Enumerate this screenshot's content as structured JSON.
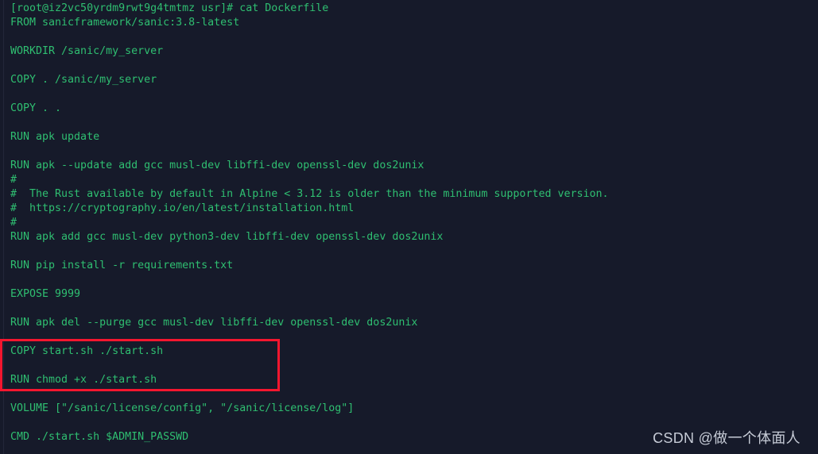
{
  "terminal": {
    "prompt_line": "[root@iz2vc50yrdm9rwt9g4tmtmz usr]# cat Dockerfile",
    "colors": {
      "background": "#161a2a",
      "text_green": "#2fbf71",
      "highlight_red": "#f4162f",
      "watermark_gray": "#c6cbd6"
    },
    "lines": [
      "[root@iz2vc50yrdm9rwt9g4tmtmz usr]# cat Dockerfile",
      "FROM sanicframework/sanic:3.8-latest",
      "",
      "WORKDIR /sanic/my_server",
      "",
      "COPY . /sanic/my_server",
      "",
      "COPY . .",
      "",
      "RUN apk update",
      "",
      "RUN apk --update add gcc musl-dev libffi-dev openssl-dev dos2unix",
      "#",
      "#  The Rust available by default in Alpine < 3.12 is older than the minimum supported version.",
      "#  https://cryptography.io/en/latest/installation.html",
      "#",
      "RUN apk add gcc musl-dev python3-dev libffi-dev openssl-dev dos2unix",
      "",
      "RUN pip install -r requirements.txt",
      "",
      "EXPOSE 9999",
      "",
      "RUN apk del --purge gcc musl-dev libffi-dev openssl-dev dos2unix",
      "",
      "COPY start.sh ./start.sh",
      "",
      "RUN chmod +x ./start.sh",
      "",
      "VOLUME [\"/sanic/license/config\", \"/sanic/license/log\"]",
      "",
      "CMD ./start.sh $ADMIN_PASSWD"
    ]
  },
  "annotation": {
    "highlighted_lines": [
      "COPY start.sh ./start.sh",
      "RUN chmod +x ./start.sh"
    ]
  },
  "watermark": {
    "text": "CSDN @做一个体面人"
  }
}
